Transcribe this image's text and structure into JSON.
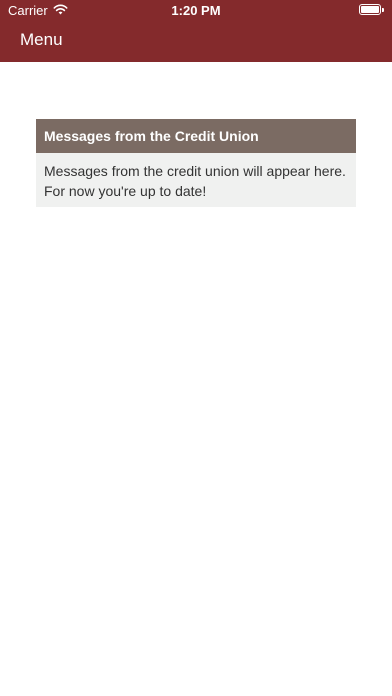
{
  "status_bar": {
    "carrier": "Carrier",
    "time": "1:20 PM",
    "battery_level": 1.0,
    "icons": [
      "wifi-icon",
      "battery-icon"
    ]
  },
  "header": {
    "menu_label": "Menu",
    "background_color": "#842a2c"
  },
  "messages_card": {
    "title": "Messages from the Credit Union",
    "line1": "Messages from the credit union will appear here.",
    "line2": "For now you're up to date!",
    "header_color": "#7b6b63",
    "body_color": "#f0f1f0"
  }
}
